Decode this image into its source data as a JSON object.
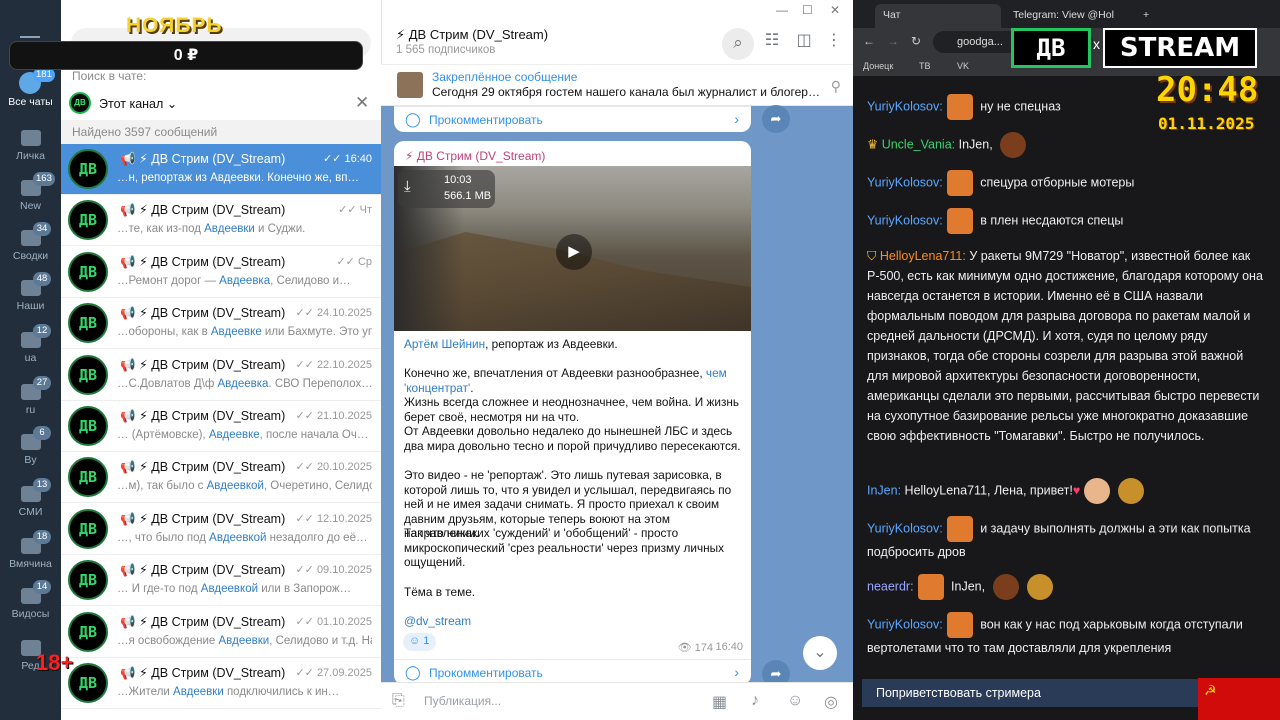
{
  "rail": {
    "items": [
      {
        "label": "Все чаты",
        "badge": "181",
        "active": true
      },
      {
        "label": "Личка",
        "badge": ""
      },
      {
        "label": "New",
        "badge": "163"
      },
      {
        "label": "Сводки",
        "badge": "34"
      },
      {
        "label": "Наши",
        "badge": "48"
      },
      {
        "label": "ua",
        "badge": "12"
      },
      {
        "label": "ru",
        "badge": "27"
      },
      {
        "label": "By",
        "badge": "6"
      },
      {
        "label": "СМИ",
        "badge": "13"
      },
      {
        "label": "Вмячина",
        "badge": "18"
      },
      {
        "label": "Видосы",
        "badge": "14"
      },
      {
        "label": "Ред",
        "badge": ""
      }
    ]
  },
  "search_panel": {
    "in_chat_label": "Поиск в чате:",
    "scope_label": "Этот канал",
    "scope_avatar": "ДВ",
    "found_text": "Найдено 3597 сообщений",
    "results": [
      {
        "name": "⚡ ДВ Стрим (DV_Stream)",
        "date": "16:40",
        "pre": "…н, репортаж из ",
        "hl": "Авдеевки",
        "post": ".  Конечно же, вп…",
        "selected": true
      },
      {
        "name": "⚡ ДВ Стрим (DV_Stream)",
        "date": "Чт",
        "pre": "…те, как из-под ",
        "hl": "Авдеевки",
        "post": " и Суджи."
      },
      {
        "name": "⚡ ДВ Стрим (DV_Stream)",
        "date": "Ср",
        "pre": "…Ремонт дорог — ",
        "hl": "Авдеевка",
        "post": ", Селидово и…"
      },
      {
        "name": "⚡ ДВ Стрим (DV_Stream)",
        "date": "24.10.2025",
        "pre": "…обороны, как в ",
        "hl": "Авдеевке",
        "post": " или Бахмуте. Это уп…"
      },
      {
        "name": "⚡ ДВ Стрим (DV_Stream)",
        "date": "22.10.2025",
        "pre": "…С.Довлатов Д\\ф ",
        "hl": "Авдеевка",
        "post": ". СВО Переполох…"
      },
      {
        "name": "⚡ ДВ Стрим (DV_Stream)",
        "date": "21.10.2025",
        "pre": "… (Артёмовске), ",
        "hl": "Авдеевке",
        "post": ", после начала Оч…"
      },
      {
        "name": "⚡ ДВ Стрим (DV_Stream)",
        "date": "20.10.2025",
        "pre": "…м), так было с ",
        "hl": "Авдеевкой",
        "post": ", Очеретино, Селидо…"
      },
      {
        "name": "⚡ ДВ Стрим (DV_Stream)",
        "date": "12.10.2025",
        "pre": "…, что было под ",
        "hl": "Авдеевкой",
        "post": " незадолго до её…"
      },
      {
        "name": "⚡ ДВ Стрим (DV_Stream)",
        "date": "09.10.2025",
        "pre": "… И где-то под ",
        "hl": "Авдеевкой",
        "post": " или в Запорож…"
      },
      {
        "name": "⚡ ДВ Стрим (DV_Stream)",
        "date": "01.10.2025",
        "pre": "…я освобождение ",
        "hl": "Авдеевки",
        "post": ", Селидово и т.д. На…"
      },
      {
        "name": "⚡ ДВ Стрим (DV_Stream)",
        "date": "27.09.2025",
        "pre": "…Жители ",
        "hl": "Авдеевки",
        "post": " подключились к ин…"
      }
    ]
  },
  "chat": {
    "title": "⚡ ДВ Стрим (DV_Stream)",
    "subscribers": "1 565 подписчиков",
    "pinned_title": "Закреплённое сообщение",
    "pinned_text": "Сегодня 29 октября гостем нашего канала был журналист и блогер…",
    "comment_label": "Прокомментировать",
    "post": {
      "author": "⚡ ДВ Стрим (DV_Stream)",
      "video_duration": "10:03",
      "video_size": "566.1 MB",
      "lead_name": "Артём Шейнин",
      "lead_rest": ", репортаж из Авдеевки.",
      "p1_pre": "Конечно же, впечатления от Авдеевки разнообразнее, ",
      "p1_link": "чем 'концентрат'",
      "p1_post": ".",
      "p2": "Жизнь всегда сложнее и неоднозначнее, чем война. И жизнь берет своё, несмотря ни на что.",
      "p3": "От Авдеевки довольно недалеко до нынешней ЛБС и здесь два мира довольно тесно и порой причудливо пересекаются.",
      "p4": "Это видео - не 'репортаж'. Это лишь путевая зарисовка, в которой лишь то, что я увидел и услышал, передвигаясь по ней и не имея задачи снимать. Я просто приехал к своим давним друзьям, которые теперь воюют на этом направлении.",
      "p5": "Так что никаких 'суждений' и 'обобщений' - просто микроскопический 'срез реальности' через призму личных ощущений.",
      "p6": "Тёма в теме.",
      "tag": "@dv_stream",
      "reaction": "1",
      "views": "174",
      "time": "16:40"
    },
    "composer_placeholder": "Публикация..."
  },
  "browser": {
    "tab1": "Чат",
    "tab2": "Telegram: View @Hol",
    "url": "goodga...",
    "bookmarks": [
      "Донецк",
      "ТВ",
      "VK"
    ],
    "logo_left": "ДВ",
    "logo_x": "x",
    "logo_right": "STREAM",
    "clock": "20:48",
    "date": "01.11.2025",
    "greet_button": "Поприветствовать стримера",
    "messages": [
      {
        "user": "YuriyKolosov:",
        "color": "#5ba8ff",
        "text": "ну не спецназ"
      },
      {
        "user": "Uncle_Vania:",
        "color": "#3bd16f",
        "text": "InJen,"
      },
      {
        "user": "YuriyKolosov:",
        "color": "#5ba8ff",
        "text": "спецура отборные мотеры"
      },
      {
        "user": "YuriyKolosov:",
        "color": "#5ba8ff",
        "text": "в плен несдаются спецы"
      },
      {
        "user": "HelloyLena711:",
        "color": "#ff8c1a",
        "text": "У ракеты 9М729 \"Новатор\", известной более как Р-500, есть как минимум одно достижение, благодаря которому она навсегда останется в истории. Именно её в США назвали формальным поводом для разрыва договора по ракетам малой и средней дальности (ДРСМД). И хотя, судя по целому ряду признаков, тогда обе стороны созрели для разрыва этой важной для мировой архитектуры безопасности договоренности, американцы сделали это первыми, рассчитывая быстро перевести на сухопутное базирование рельсы уже многократно доказавшие свою эффективность \"Томагавки\". Быстро не получилось."
      },
      {
        "user": "InJen:",
        "color": "#5ba8ff",
        "text": "HelloyLena711, Лена, привет!"
      },
      {
        "user": "YuriyKolosov:",
        "color": "#5ba8ff",
        "text": "и задачу выполнять должны а эти как попытка подбросить дров"
      },
      {
        "user": "neaerdr:",
        "color": "#9aa6ff",
        "text": "InJen,"
      },
      {
        "user": "YuriyKolosov:",
        "color": "#5ba8ff",
        "text": "вон как у нас под харьковым когда отступали вертолетами что то там доставляли для укрепления"
      }
    ]
  },
  "overlay": {
    "month": "НОЯБРЬ",
    "balance": "0 ₽",
    "age": "18+"
  }
}
